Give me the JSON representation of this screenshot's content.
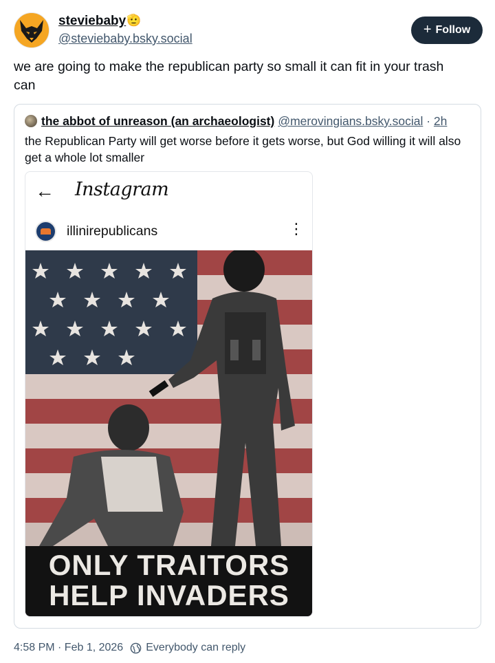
{
  "post": {
    "author": {
      "display_name": "steviebaby",
      "emoji": "🫡",
      "handle": "@steviebaby.bsky.social",
      "avatar_icon": "wolf-logo-icon"
    },
    "follow_label": "Follow",
    "text": "we are going to make the republican party so small it can fit in your trash can"
  },
  "quote": {
    "author": {
      "display_name": "the abbot of unreason (an archaeologist)",
      "handle": "@merovingians.bsky.social",
      "time": "2h"
    },
    "text": "the Republican Party will get worse before it gets worse, but God willing it will also get a whole lot smaller",
    "embed": {
      "app_title": "Instagram",
      "username": "illinirepublicans",
      "image_caption_line1": "ONLY TRAITORS",
      "image_caption_line2": "HELP INVADERS"
    }
  },
  "footer": {
    "timestamp": "4:58 PM · Feb 1, 2026",
    "reply_setting": "Everybody can reply"
  },
  "colors": {
    "follow_button": "#1c2b3a",
    "muted_text": "#42576c",
    "border": "#d4dbe2",
    "avatar_orange": "#f5a623"
  }
}
